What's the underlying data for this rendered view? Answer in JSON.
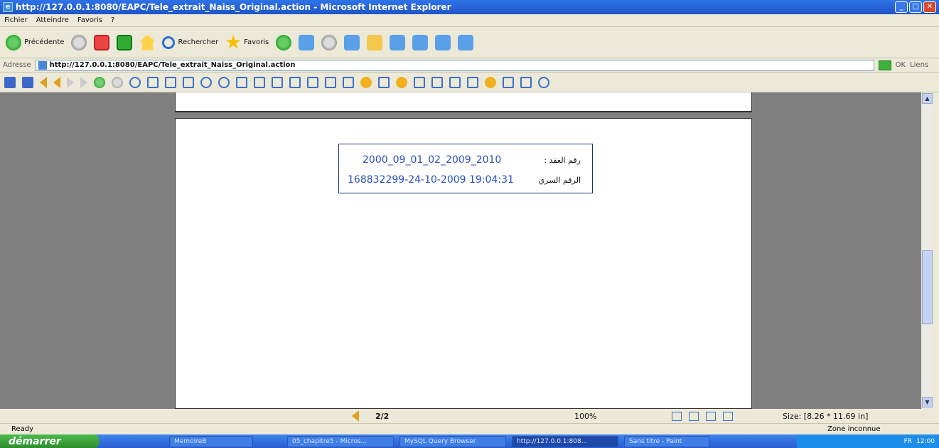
{
  "window": {
    "title": "http://127.0.0.1:8080/EAPC/Tele_extrait_Naiss_Original.action - Microsoft Internet Explorer",
    "close_glyph": "✕",
    "min_glyph": "_",
    "max_glyph": "□"
  },
  "menu": [
    "Fichier",
    "Atteindre",
    "Favoris",
    "?"
  ],
  "toolbar": {
    "back_label": "Précédente",
    "search_label": "Rechercher",
    "favorites_label": "Favoris"
  },
  "address": {
    "label": "Adresse",
    "url": "http://127.0.0.1:8080/EAPC/Tele_extrait_Naiss_Original.action",
    "go_label": "OK",
    "links_label": "Liens"
  },
  "document": {
    "contract_label": "رقم العقد :",
    "contract_value": "2000_09_01_02_2009_2010",
    "secret_label": "الرقم السري",
    "secret_value": "168832299-24-10-2009 19:04:31"
  },
  "viewer_nav": {
    "page": "2/2",
    "zoom": "100%",
    "size": "Size: [8.26 * 11.69 in]"
  },
  "status": {
    "text": "Ready",
    "zone": "Zone inconnue"
  },
  "taskbar": {
    "start": "démarrer",
    "items": [
      "MemoireB",
      "05_chapitre5 - Micros...",
      "MySQL Query Browser",
      "http://127.0.0.1:808...",
      "Sans titre - Paint"
    ],
    "lang": "FR",
    "clock": "12:00"
  },
  "colors": {
    "accent": "#2a4fc0",
    "titlebar": "#2f73e8"
  }
}
